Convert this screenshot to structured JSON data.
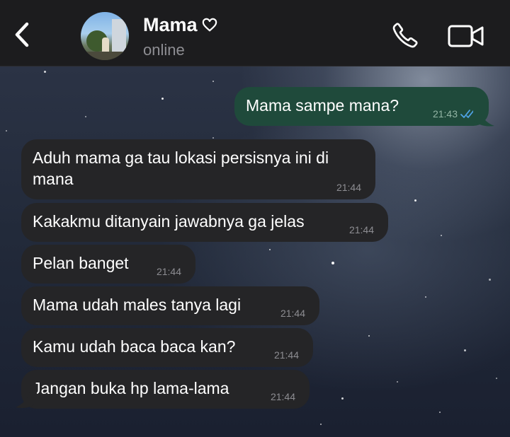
{
  "header": {
    "contact_name": "Mama",
    "status": "online"
  },
  "messages": [
    {
      "direction": "out",
      "text": "Mama sampe mana?",
      "time": "21:43"
    },
    {
      "direction": "in",
      "text_line1": "Aduh mama ga tau lokasi persisnya ini di",
      "text_line2": "mana",
      "time": "21:44"
    },
    {
      "direction": "in",
      "text": "Kakakmu ditanyain jawabnya ga jelas",
      "time": "21:44"
    },
    {
      "direction": "in",
      "text": "Pelan banget",
      "time": "21:44"
    },
    {
      "direction": "in",
      "text": "Mama udah males tanya lagi",
      "time": "21:44"
    },
    {
      "direction": "in",
      "text": "Kamu udah baca baca kan?",
      "time": "21:44"
    },
    {
      "direction": "in",
      "text": "Jangan buka hp lama-lama",
      "time": "21:44"
    }
  ],
  "icons": {
    "back": "chevron-left-icon",
    "call": "phone-icon",
    "video": "video-camera-icon",
    "read_receipt": "double-check-icon",
    "name_suffix": "heart-icon"
  },
  "colors": {
    "header_bg": "#1c1c1e",
    "incoming_bubble": "#252527",
    "outgoing_bubble": "#1f4a3b",
    "read_tick": "#4fa3e6"
  }
}
